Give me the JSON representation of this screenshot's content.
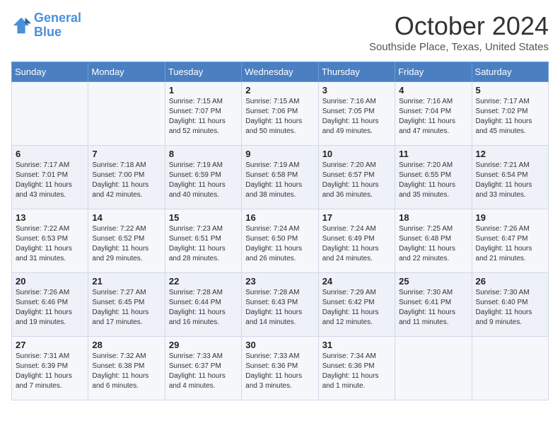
{
  "header": {
    "logo_line1": "General",
    "logo_line2": "Blue",
    "month_title": "October 2024",
    "location": "Southside Place, Texas, United States"
  },
  "days_of_week": [
    "Sunday",
    "Monday",
    "Tuesday",
    "Wednesday",
    "Thursday",
    "Friday",
    "Saturday"
  ],
  "weeks": [
    [
      {
        "day": "",
        "sunrise": "",
        "sunset": "",
        "daylight": ""
      },
      {
        "day": "",
        "sunrise": "",
        "sunset": "",
        "daylight": ""
      },
      {
        "day": "1",
        "sunrise": "Sunrise: 7:15 AM",
        "sunset": "Sunset: 7:07 PM",
        "daylight": "Daylight: 11 hours and 52 minutes."
      },
      {
        "day": "2",
        "sunrise": "Sunrise: 7:15 AM",
        "sunset": "Sunset: 7:06 PM",
        "daylight": "Daylight: 11 hours and 50 minutes."
      },
      {
        "day": "3",
        "sunrise": "Sunrise: 7:16 AM",
        "sunset": "Sunset: 7:05 PM",
        "daylight": "Daylight: 11 hours and 49 minutes."
      },
      {
        "day": "4",
        "sunrise": "Sunrise: 7:16 AM",
        "sunset": "Sunset: 7:04 PM",
        "daylight": "Daylight: 11 hours and 47 minutes."
      },
      {
        "day": "5",
        "sunrise": "Sunrise: 7:17 AM",
        "sunset": "Sunset: 7:02 PM",
        "daylight": "Daylight: 11 hours and 45 minutes."
      }
    ],
    [
      {
        "day": "6",
        "sunrise": "Sunrise: 7:17 AM",
        "sunset": "Sunset: 7:01 PM",
        "daylight": "Daylight: 11 hours and 43 minutes."
      },
      {
        "day": "7",
        "sunrise": "Sunrise: 7:18 AM",
        "sunset": "Sunset: 7:00 PM",
        "daylight": "Daylight: 11 hours and 42 minutes."
      },
      {
        "day": "8",
        "sunrise": "Sunrise: 7:19 AM",
        "sunset": "Sunset: 6:59 PM",
        "daylight": "Daylight: 11 hours and 40 minutes."
      },
      {
        "day": "9",
        "sunrise": "Sunrise: 7:19 AM",
        "sunset": "Sunset: 6:58 PM",
        "daylight": "Daylight: 11 hours and 38 minutes."
      },
      {
        "day": "10",
        "sunrise": "Sunrise: 7:20 AM",
        "sunset": "Sunset: 6:57 PM",
        "daylight": "Daylight: 11 hours and 36 minutes."
      },
      {
        "day": "11",
        "sunrise": "Sunrise: 7:20 AM",
        "sunset": "Sunset: 6:55 PM",
        "daylight": "Daylight: 11 hours and 35 minutes."
      },
      {
        "day": "12",
        "sunrise": "Sunrise: 7:21 AM",
        "sunset": "Sunset: 6:54 PM",
        "daylight": "Daylight: 11 hours and 33 minutes."
      }
    ],
    [
      {
        "day": "13",
        "sunrise": "Sunrise: 7:22 AM",
        "sunset": "Sunset: 6:53 PM",
        "daylight": "Daylight: 11 hours and 31 minutes."
      },
      {
        "day": "14",
        "sunrise": "Sunrise: 7:22 AM",
        "sunset": "Sunset: 6:52 PM",
        "daylight": "Daylight: 11 hours and 29 minutes."
      },
      {
        "day": "15",
        "sunrise": "Sunrise: 7:23 AM",
        "sunset": "Sunset: 6:51 PM",
        "daylight": "Daylight: 11 hours and 28 minutes."
      },
      {
        "day": "16",
        "sunrise": "Sunrise: 7:24 AM",
        "sunset": "Sunset: 6:50 PM",
        "daylight": "Daylight: 11 hours and 26 minutes."
      },
      {
        "day": "17",
        "sunrise": "Sunrise: 7:24 AM",
        "sunset": "Sunset: 6:49 PM",
        "daylight": "Daylight: 11 hours and 24 minutes."
      },
      {
        "day": "18",
        "sunrise": "Sunrise: 7:25 AM",
        "sunset": "Sunset: 6:48 PM",
        "daylight": "Daylight: 11 hours and 22 minutes."
      },
      {
        "day": "19",
        "sunrise": "Sunrise: 7:26 AM",
        "sunset": "Sunset: 6:47 PM",
        "daylight": "Daylight: 11 hours and 21 minutes."
      }
    ],
    [
      {
        "day": "20",
        "sunrise": "Sunrise: 7:26 AM",
        "sunset": "Sunset: 6:46 PM",
        "daylight": "Daylight: 11 hours and 19 minutes."
      },
      {
        "day": "21",
        "sunrise": "Sunrise: 7:27 AM",
        "sunset": "Sunset: 6:45 PM",
        "daylight": "Daylight: 11 hours and 17 minutes."
      },
      {
        "day": "22",
        "sunrise": "Sunrise: 7:28 AM",
        "sunset": "Sunset: 6:44 PM",
        "daylight": "Daylight: 11 hours and 16 minutes."
      },
      {
        "day": "23",
        "sunrise": "Sunrise: 7:28 AM",
        "sunset": "Sunset: 6:43 PM",
        "daylight": "Daylight: 11 hours and 14 minutes."
      },
      {
        "day": "24",
        "sunrise": "Sunrise: 7:29 AM",
        "sunset": "Sunset: 6:42 PM",
        "daylight": "Daylight: 11 hours and 12 minutes."
      },
      {
        "day": "25",
        "sunrise": "Sunrise: 7:30 AM",
        "sunset": "Sunset: 6:41 PM",
        "daylight": "Daylight: 11 hours and 11 minutes."
      },
      {
        "day": "26",
        "sunrise": "Sunrise: 7:30 AM",
        "sunset": "Sunset: 6:40 PM",
        "daylight": "Daylight: 11 hours and 9 minutes."
      }
    ],
    [
      {
        "day": "27",
        "sunrise": "Sunrise: 7:31 AM",
        "sunset": "Sunset: 6:39 PM",
        "daylight": "Daylight: 11 hours and 7 minutes."
      },
      {
        "day": "28",
        "sunrise": "Sunrise: 7:32 AM",
        "sunset": "Sunset: 6:38 PM",
        "daylight": "Daylight: 11 hours and 6 minutes."
      },
      {
        "day": "29",
        "sunrise": "Sunrise: 7:33 AM",
        "sunset": "Sunset: 6:37 PM",
        "daylight": "Daylight: 11 hours and 4 minutes."
      },
      {
        "day": "30",
        "sunrise": "Sunrise: 7:33 AM",
        "sunset": "Sunset: 6:36 PM",
        "daylight": "Daylight: 11 hours and 3 minutes."
      },
      {
        "day": "31",
        "sunrise": "Sunrise: 7:34 AM",
        "sunset": "Sunset: 6:36 PM",
        "daylight": "Daylight: 11 hours and 1 minute."
      },
      {
        "day": "",
        "sunrise": "",
        "sunset": "",
        "daylight": ""
      },
      {
        "day": "",
        "sunrise": "",
        "sunset": "",
        "daylight": ""
      }
    ]
  ]
}
